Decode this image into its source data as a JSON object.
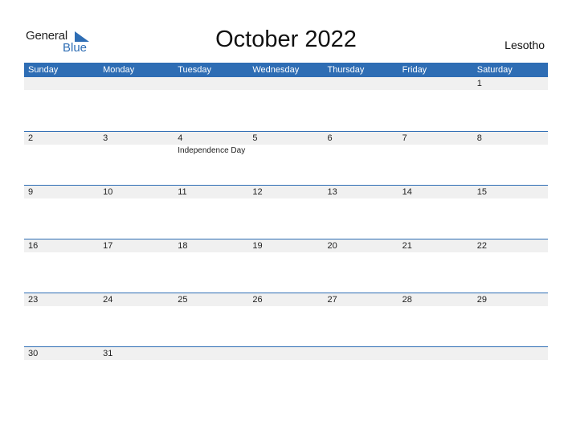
{
  "logo": {
    "general": "General",
    "blue": "Blue"
  },
  "title": "October 2022",
  "country": "Lesotho",
  "colors": {
    "accent": "#2e6db4",
    "band": "#f0f0f0"
  },
  "weekdays": [
    "Sunday",
    "Monday",
    "Tuesday",
    "Wednesday",
    "Thursday",
    "Friday",
    "Saturday"
  ],
  "weeks": [
    {
      "days": [
        "",
        "",
        "",
        "",
        "",
        "",
        "1"
      ],
      "events": [
        "",
        "",
        "",
        "",
        "",
        "",
        ""
      ]
    },
    {
      "days": [
        "2",
        "3",
        "4",
        "5",
        "6",
        "7",
        "8"
      ],
      "events": [
        "",
        "",
        "Independence Day",
        "",
        "",
        "",
        ""
      ]
    },
    {
      "days": [
        "9",
        "10",
        "11",
        "12",
        "13",
        "14",
        "15"
      ],
      "events": [
        "",
        "",
        "",
        "",
        "",
        "",
        ""
      ]
    },
    {
      "days": [
        "16",
        "17",
        "18",
        "19",
        "20",
        "21",
        "22"
      ],
      "events": [
        "",
        "",
        "",
        "",
        "",
        "",
        ""
      ]
    },
    {
      "days": [
        "23",
        "24",
        "25",
        "26",
        "27",
        "28",
        "29"
      ],
      "events": [
        "",
        "",
        "",
        "",
        "",
        "",
        ""
      ]
    },
    {
      "days": [
        "30",
        "31",
        "",
        "",
        "",
        "",
        ""
      ],
      "events": [
        "",
        "",
        "",
        "",
        "",
        "",
        ""
      ]
    }
  ]
}
